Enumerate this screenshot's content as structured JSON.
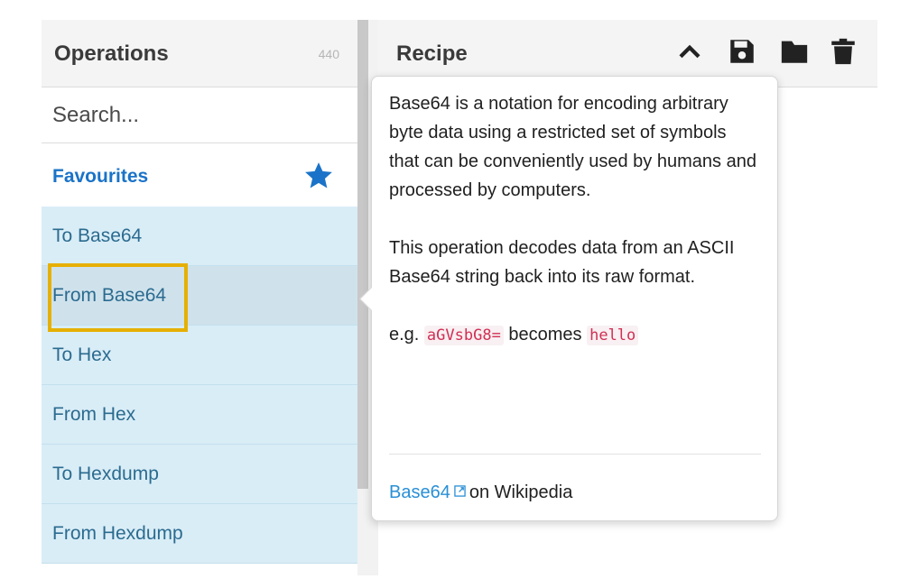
{
  "operations": {
    "title": "Operations",
    "count": "440",
    "search_placeholder": "Search...",
    "favourites_label": "Favourites",
    "items": [
      {
        "label": "To Base64"
      },
      {
        "label": "From Base64"
      },
      {
        "label": "To Hex"
      },
      {
        "label": "From Hex"
      },
      {
        "label": "To Hexdump"
      },
      {
        "label": "From Hexdump"
      }
    ]
  },
  "recipe": {
    "title": "Recipe",
    "icons": [
      "chevron-up-icon",
      "save-icon",
      "folder-icon",
      "trash-icon"
    ]
  },
  "popover": {
    "paragraph1": "Base64 is a notation for encoding arbitrary byte data using a restricted set of symbols that can be conveniently used by humans and processed by computers.",
    "paragraph2": "This operation decodes data from an ASCII Base64 string back into its raw format.",
    "example_prefix": "e.g.",
    "example_input": "aGVsbG8=",
    "example_mid": "becomes",
    "example_output": "hello",
    "link_text": "Base64",
    "link_suffix": "on Wikipedia"
  },
  "colors": {
    "accent": "#1a73c8",
    "list_bg": "#d9edf7",
    "highlight": "#e6b000",
    "code": "#d12f54",
    "link": "#2a8fd6"
  }
}
